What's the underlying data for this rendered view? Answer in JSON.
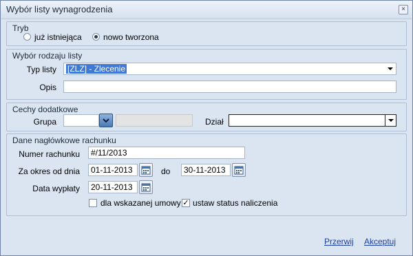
{
  "window": {
    "title": "Wybór listy wynagrodzenia",
    "close_icon": "close-icon"
  },
  "tryb": {
    "title": "Tryb",
    "option_existing": "już istniejąca",
    "option_new": "nowo tworzona",
    "selected": "nowo tworzona"
  },
  "rodzaj": {
    "title": "Wybór rodzaju listy",
    "typ_label": "Typ listy",
    "typ_value": "[ZLZ] - Zlecenie",
    "opis_label": "Opis",
    "opis_value": ""
  },
  "cechy": {
    "title": "Cechy dodatkowe",
    "grupa_label": "Grupa",
    "grupa_value": "",
    "dzial_label": "Dział",
    "dzial_value": ""
  },
  "naglowek": {
    "title": "Dane nagłówkowe rachunku",
    "numer_label": "Numer rachunku",
    "numer_value": "#/11/2013",
    "okres_label": "Za okres od dnia",
    "okres_od": "01-11-2013",
    "do_label": "do",
    "okres_do": "30-11-2013",
    "data_label": "Data wypłaty",
    "data_value": "20-11-2013",
    "check_umowy_label": "dla wskazanej umowy",
    "check_umowy_checked": false,
    "check_status_label": "ustaw status naliczenia",
    "check_status_checked": true
  },
  "footer": {
    "cancel": "Przerwij",
    "accept": "Akceptuj"
  }
}
